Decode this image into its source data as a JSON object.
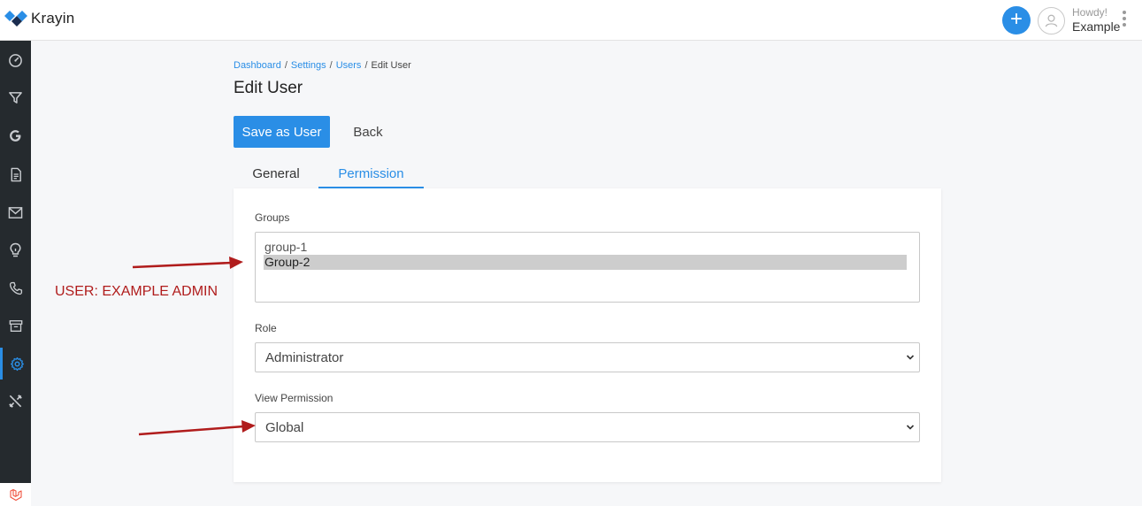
{
  "app": {
    "name": "Krayin"
  },
  "header": {
    "greeting": "Howdy!",
    "user_name": "Example"
  },
  "sidebar": {
    "items": [
      {
        "icon": "dashboard-icon"
      },
      {
        "icon": "funnel-icon"
      },
      {
        "icon": "google-icon"
      },
      {
        "icon": "document-icon"
      },
      {
        "icon": "mail-icon"
      },
      {
        "icon": "bulb-icon"
      },
      {
        "icon": "phone-icon"
      },
      {
        "icon": "archive-icon"
      },
      {
        "icon": "gear-icon",
        "active": true
      },
      {
        "icon": "tools-icon"
      }
    ]
  },
  "breadcrumb": [
    "Dashboard",
    "Settings",
    "Users",
    "Edit User"
  ],
  "page": {
    "title": "Edit User"
  },
  "actions": {
    "save_label": "Save as User",
    "back_label": "Back"
  },
  "tabs": [
    {
      "label": "General",
      "active": false
    },
    {
      "label": "Permission",
      "active": true
    }
  ],
  "form": {
    "groups": {
      "label": "Groups",
      "options": [
        {
          "label": "group-1",
          "selected": false
        },
        {
          "label": "Group-2",
          "selected": true
        }
      ]
    },
    "role": {
      "label": "Role",
      "value": "Administrator"
    },
    "view_permission": {
      "label": "View Permission",
      "value": "Global"
    }
  },
  "annotation": {
    "text": "USER: EXAMPLE ADMIN",
    "color": "#b01c1c"
  },
  "colors": {
    "accent": "#2a8ee6",
    "sidebar": "#252a2e"
  }
}
